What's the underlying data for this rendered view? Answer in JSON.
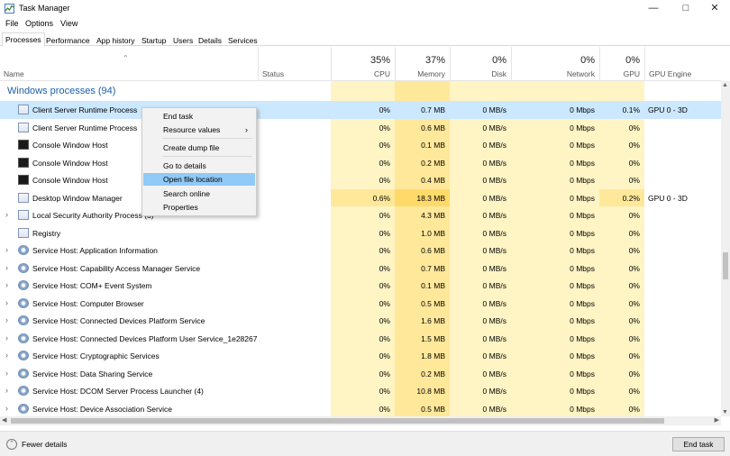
{
  "window": {
    "title": "Task Manager"
  },
  "menu": [
    "File",
    "Options",
    "View"
  ],
  "tabs": [
    "Processes",
    "Performance",
    "App history",
    "Startup",
    "Users",
    "Details",
    "Services"
  ],
  "header": {
    "name": "Name",
    "status": "Status",
    "cpu": {
      "pct": "35%",
      "label": "CPU"
    },
    "memory": {
      "pct": "37%",
      "label": "Memory"
    },
    "disk": {
      "pct": "0%",
      "label": "Disk"
    },
    "network": {
      "pct": "0%",
      "label": "Network"
    },
    "gpu": {
      "pct": "0%",
      "label": "GPU"
    },
    "gpu_engine": "GPU Engine"
  },
  "group_title": "Windows processes (94)",
  "rows": [
    {
      "name": "Client Server Runtime Process",
      "icon": "generic",
      "expand": false,
      "cpu": "0%",
      "mem": "0.7 MB",
      "disk": "0 MB/s",
      "net": "0 Mbps",
      "gpu": "0.1%",
      "eng": "GPU 0 - 3D",
      "selected": true
    },
    {
      "name": "Client Server Runtime Process",
      "icon": "generic",
      "expand": false,
      "cpu": "0%",
      "mem": "0.6 MB",
      "disk": "0 MB/s",
      "net": "0 Mbps",
      "gpu": "0%",
      "eng": ""
    },
    {
      "name": "Console Window Host",
      "icon": "console",
      "expand": false,
      "cpu": "0%",
      "mem": "0.1 MB",
      "disk": "0 MB/s",
      "net": "0 Mbps",
      "gpu": "0%",
      "eng": ""
    },
    {
      "name": "Console Window Host",
      "icon": "console",
      "expand": false,
      "cpu": "0%",
      "mem": "0.2 MB",
      "disk": "0 MB/s",
      "net": "0 Mbps",
      "gpu": "0%",
      "eng": ""
    },
    {
      "name": "Console Window Host",
      "icon": "console",
      "expand": false,
      "cpu": "0%",
      "mem": "0.4 MB",
      "disk": "0 MB/s",
      "net": "0 Mbps",
      "gpu": "0%",
      "eng": ""
    },
    {
      "name": "Desktop Window Manager",
      "icon": "generic",
      "expand": false,
      "cpu": "0.6%",
      "mem": "18.3 MB",
      "disk": "0 MB/s",
      "net": "0 Mbps",
      "gpu": "0.2%",
      "eng": "GPU 0 - 3D",
      "hot": true
    },
    {
      "name": "Local Security Authority Process (3)",
      "icon": "generic",
      "expand": true,
      "cpu": "0%",
      "mem": "4.3 MB",
      "disk": "0 MB/s",
      "net": "0 Mbps",
      "gpu": "0%",
      "eng": ""
    },
    {
      "name": "Registry",
      "icon": "generic",
      "expand": false,
      "cpu": "0%",
      "mem": "1.0 MB",
      "disk": "0 MB/s",
      "net": "0 Mbps",
      "gpu": "0%",
      "eng": ""
    },
    {
      "name": "Service Host: Application Information",
      "icon": "gear",
      "expand": true,
      "cpu": "0%",
      "mem": "0.6 MB",
      "disk": "0 MB/s",
      "net": "0 Mbps",
      "gpu": "0%",
      "eng": ""
    },
    {
      "name": "Service Host: Capability Access Manager Service",
      "icon": "gear",
      "expand": true,
      "cpu": "0%",
      "mem": "0.7 MB",
      "disk": "0 MB/s",
      "net": "0 Mbps",
      "gpu": "0%",
      "eng": ""
    },
    {
      "name": "Service Host: COM+ Event System",
      "icon": "gear",
      "expand": true,
      "cpu": "0%",
      "mem": "0.1 MB",
      "disk": "0 MB/s",
      "net": "0 Mbps",
      "gpu": "0%",
      "eng": ""
    },
    {
      "name": "Service Host: Computer Browser",
      "icon": "gear",
      "expand": true,
      "cpu": "0%",
      "mem": "0.5 MB",
      "disk": "0 MB/s",
      "net": "0 Mbps",
      "gpu": "0%",
      "eng": ""
    },
    {
      "name": "Service Host: Connected Devices Platform Service",
      "icon": "gear",
      "expand": true,
      "cpu": "0%",
      "mem": "1.6 MB",
      "disk": "0 MB/s",
      "net": "0 Mbps",
      "gpu": "0%",
      "eng": ""
    },
    {
      "name": "Service Host: Connected Devices Platform User Service_1e28267",
      "icon": "gear",
      "expand": true,
      "cpu": "0%",
      "mem": "1.5 MB",
      "disk": "0 MB/s",
      "net": "0 Mbps",
      "gpu": "0%",
      "eng": ""
    },
    {
      "name": "Service Host: Cryptographic Services",
      "icon": "gear",
      "expand": true,
      "cpu": "0%",
      "mem": "1.8 MB",
      "disk": "0 MB/s",
      "net": "0 Mbps",
      "gpu": "0%",
      "eng": ""
    },
    {
      "name": "Service Host: Data Sharing Service",
      "icon": "gear",
      "expand": true,
      "cpu": "0%",
      "mem": "0.2 MB",
      "disk": "0 MB/s",
      "net": "0 Mbps",
      "gpu": "0%",
      "eng": ""
    },
    {
      "name": "Service Host: DCOM Server Process Launcher (4)",
      "icon": "gear",
      "expand": true,
      "cpu": "0%",
      "mem": "10.8 MB",
      "disk": "0 MB/s",
      "net": "0 Mbps",
      "gpu": "0%",
      "eng": ""
    },
    {
      "name": "Service Host: Device Association Service",
      "icon": "gear",
      "expand": true,
      "cpu": "0%",
      "mem": "0.5 MB",
      "disk": "0 MB/s",
      "net": "0 Mbps",
      "gpu": "0%",
      "eng": ""
    }
  ],
  "context_menu": {
    "items": [
      "End task",
      "Resource values",
      "Create dump file",
      "Go to details",
      "Open file location",
      "Search online",
      "Properties"
    ],
    "highlighted": "Open file location",
    "submenu_arrow": "›"
  },
  "footer": {
    "fewer_details": "Fewer details",
    "end_task": "End task"
  },
  "colors": {
    "selected_row": "#cce8ff",
    "heat_light": "#fff4c4",
    "heat_mid": "#ffe89a",
    "group_title": "#1e5fa6",
    "menu_highlight": "#91c9f7"
  }
}
